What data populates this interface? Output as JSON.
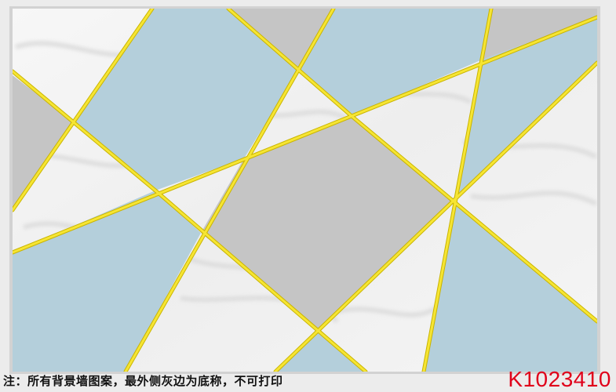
{
  "artwork": {
    "description_colors": {
      "background": "#ececec",
      "frame": "#cfcfcf",
      "marble_white": "#f2f2f2",
      "panel_blue": "#b4cfdb",
      "panel_gray": "#c5c5c5",
      "gold_line": "#f3e32a"
    }
  },
  "caption": {
    "note": "注：所有背景墙图案，最外侧灰边为底称，不可打印",
    "code": "K1023410"
  }
}
